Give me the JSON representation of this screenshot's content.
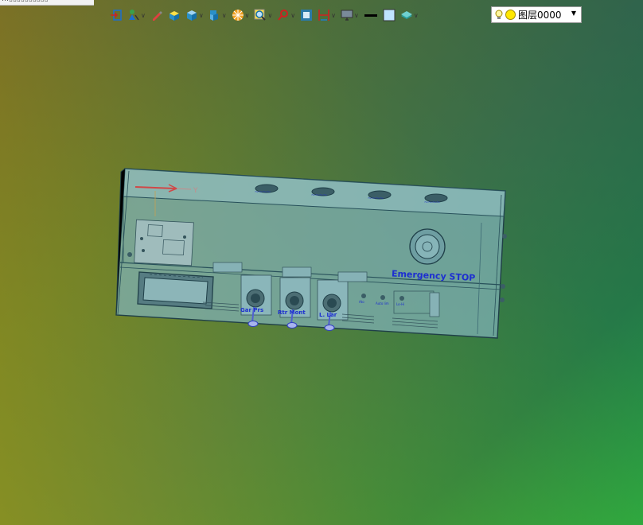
{
  "top_strip": {
    "text": "…▯▯▯▯▯▯▯▯▯▯"
  },
  "toolbar": {
    "items": [
      {
        "icon": "exit-icon"
      },
      {
        "icon": "person-pointer-icon"
      },
      {
        "icon": "pencil-icon"
      },
      {
        "icon": "solid-box-yellow-icon"
      },
      {
        "icon": "solid-box-blue-icon"
      },
      {
        "icon": "view-box-icon"
      },
      {
        "icon": "color-wheel-icon"
      },
      {
        "icon": "zoom-icon"
      },
      {
        "icon": "pin-icon"
      },
      {
        "icon": "frame-icon"
      },
      {
        "icon": "height-measure-icon"
      },
      {
        "icon": "display-icon"
      },
      {
        "icon": "line-weight-icon"
      },
      {
        "icon": "fill-color-icon"
      },
      {
        "icon": "layer-stack-icon"
      }
    ]
  },
  "layer": {
    "label": "图层0000",
    "color": "#ffe700"
  },
  "model": {
    "emergency_label": "Emergency STOP",
    "knob_labels": [
      "Gar Prs",
      "Rtr Mont",
      "L. Lar"
    ],
    "switch_labels": [
      "Ato",
      "Auto lim",
      "Lo-Hi"
    ]
  }
}
